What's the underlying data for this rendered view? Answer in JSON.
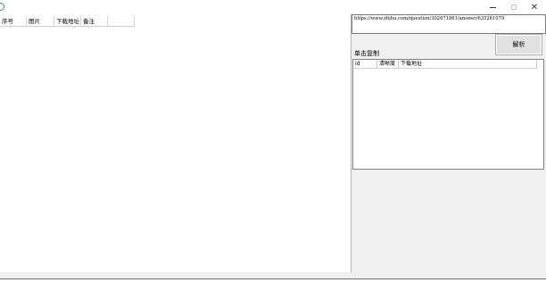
{
  "window": {
    "minimize_icon": "minimize-icon",
    "maximize_icon": "maximize-icon",
    "close_icon": "close-icon",
    "close_glyph": "✕"
  },
  "result_table": {
    "columns": [
      "序号",
      "图片",
      "下载地址",
      "备注",
      ""
    ]
  },
  "url_input": {
    "value": "https://www.zhihu.com/question/302671861/answer/635261079"
  },
  "parse_button": {
    "label": "解析"
  },
  "copy_hint": {
    "label": "单击复制"
  },
  "link_list": {
    "columns": [
      "id",
      "清晰度",
      "下载地址"
    ]
  },
  "colors": {
    "app_icon": "#2a9a6e",
    "pane_background": "#f0f0f0",
    "button_background": "#e1e1e1"
  }
}
